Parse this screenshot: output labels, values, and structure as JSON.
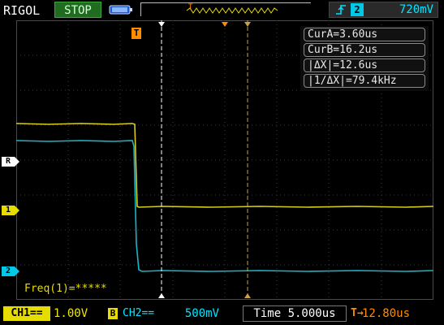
{
  "header": {
    "brand": "RIGOL",
    "run_state": "STOP",
    "trigger": {
      "edge_symbol": "⎍",
      "source": "2",
      "level": "720mV"
    }
  },
  "cursor_readout": {
    "cur_a": "CurA=3.60us",
    "cur_b": "CurB=16.2us",
    "delta_x": "|ΔX|=12.6us",
    "inv_delta_x": "|1/ΔX|=79.4kHz"
  },
  "measurement": {
    "freq": "Freq(1)=*****"
  },
  "markers": {
    "ref": "R",
    "ch1": "1",
    "ch2": "2",
    "trigger_pos": "T"
  },
  "footer": {
    "ch1_label": "CH1==",
    "ch1_scale": "1.00V",
    "ch1_bw": "B",
    "ch2_label": "CH2==",
    "ch2_scale": "500mV",
    "timebase": "Time 5.000us",
    "trigger_offset_icon": "T→",
    "trigger_offset": "12.80us"
  },
  "colors": {
    "ch1": "#e6dc00",
    "ch2": "#00c8e6",
    "trigger": "#ff8c00",
    "grid": "#4a4a4a",
    "cursor_a": "#ffffff",
    "cursor_b": "#c8a04a"
  }
}
